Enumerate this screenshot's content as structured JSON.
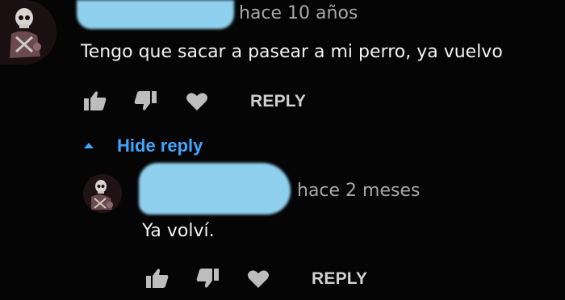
{
  "comments": [
    {
      "timestamp": "hace 10 años",
      "text": "Tengo que sacar a pasear a mi perro, ya vuelvo",
      "reply_label": "REPLY",
      "icons": [
        "thumbs-up-icon",
        "thumbs-down-icon",
        "heart-icon"
      ]
    },
    {
      "timestamp": "hace 2 meses",
      "text": "Ya volví.",
      "reply_label": "REPLY",
      "icons": [
        "thumbs-up-icon",
        "thumbs-down-icon",
        "heart-icon"
      ]
    }
  ],
  "replies_toggle": {
    "label": "Hide reply",
    "icon": "caret-up-icon"
  },
  "colors": {
    "background": "#050505",
    "link": "#3ea6ff",
    "timestamp": "#a7a7a7",
    "name_redaction": "#8fd0ee"
  }
}
